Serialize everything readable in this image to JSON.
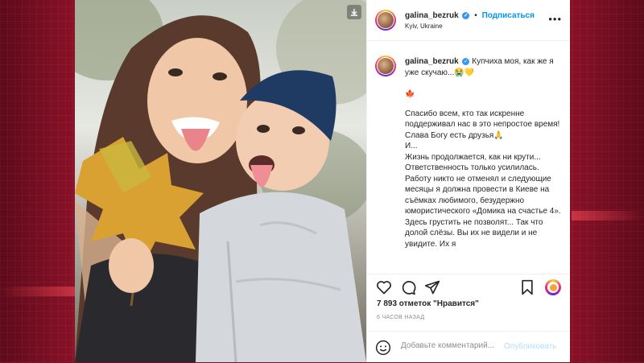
{
  "post": {
    "username": "galina_bezruk",
    "follow_label": "Подписаться",
    "location": "Kyiv, Ukraine",
    "caption_head": "Купчиха моя, как же я уже скучаю...😭💛",
    "leaf_emoji": "🍁",
    "caption_lines": [
      "Спасибо всем, кто так искренне поддерживал нас в это непростое время! Слава Богу есть друзья🙏",
      "И...",
      "Жизнь продолжается, как ни крути... Ответственность только усилилась. Работу никто не отменял и следующие месяцы я должна провести в Киеве на съёмках любимого, безудержно юмористического «Домика на счастье 4». Здесь грустить не позволят... Так что долой слёзы. Вы их не видели и не увидите. Их я"
    ],
    "likes": "7 893 отметок \"Нравится\"",
    "time_ago": "6 ЧАСОВ НАЗАД",
    "comment_placeholder": "Добавьте комментарий...",
    "publish_label": "Опубликовать"
  },
  "icons": [
    "verified-badge-icon",
    "more-options-icon",
    "heart-icon",
    "comment-icon",
    "share-icon",
    "bookmark-icon",
    "smile-icon",
    "save-photo-icon"
  ],
  "colors": {
    "accent": "#0095f6",
    "background": "#8a1127",
    "text": "#262626",
    "muted": "#8e8e8e"
  }
}
